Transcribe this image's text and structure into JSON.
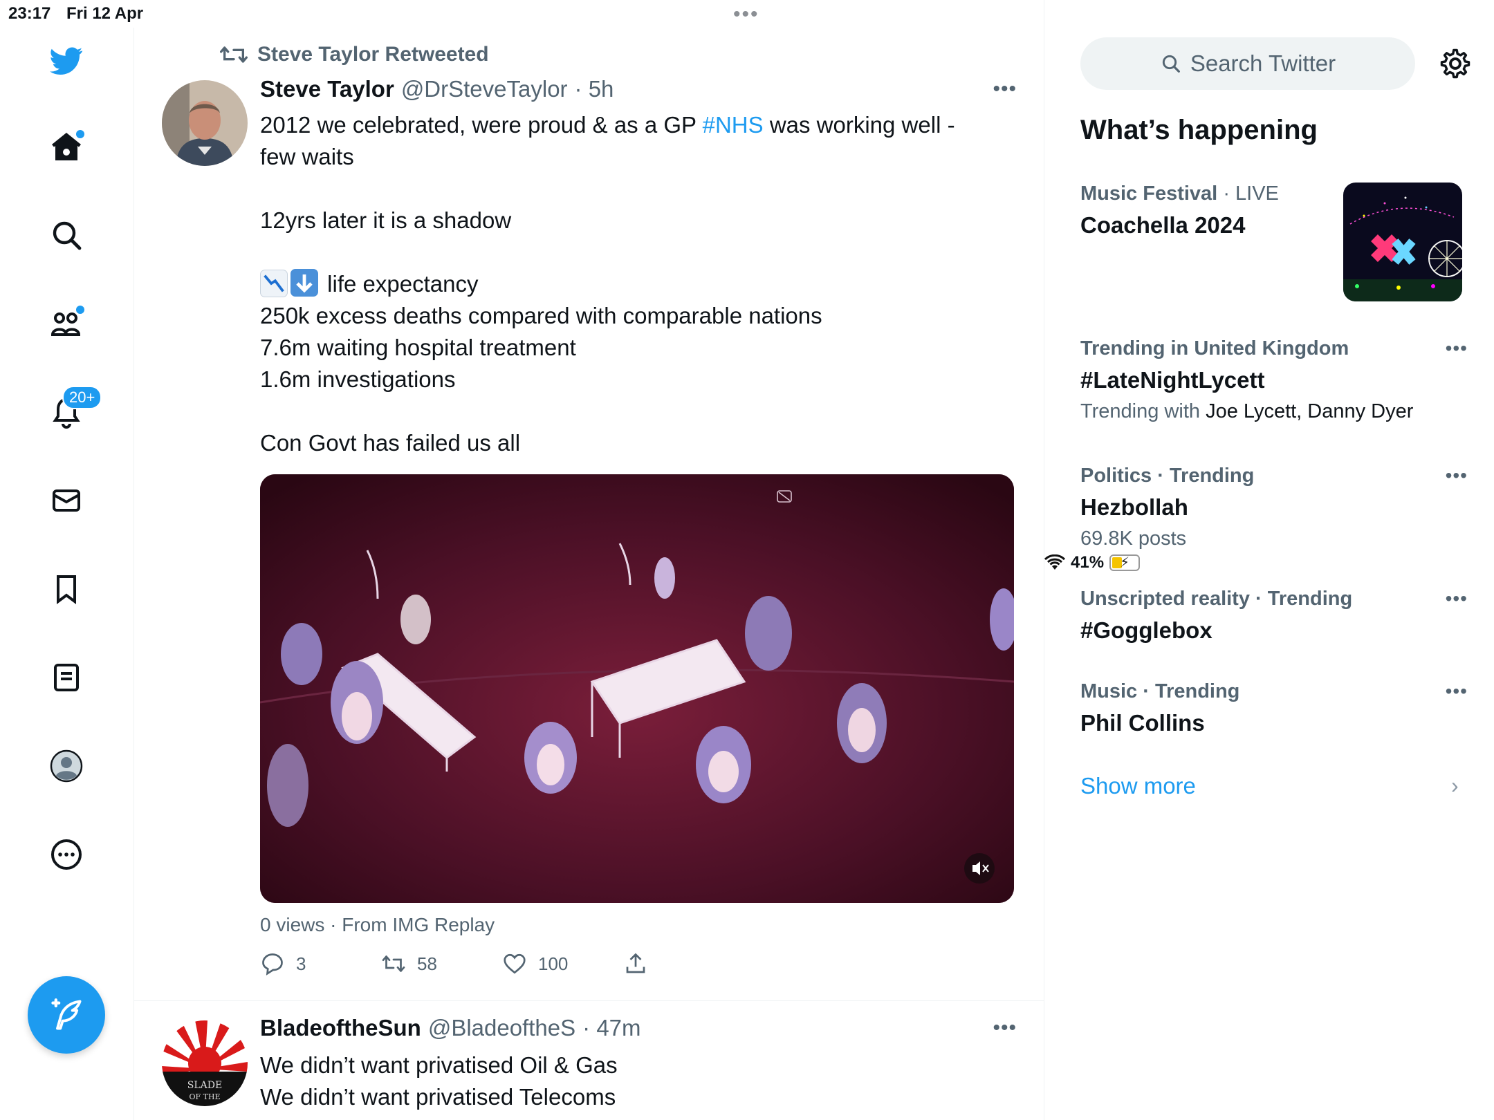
{
  "status_bar": {
    "time": "23:17",
    "date": "Fri 12 Apr",
    "battery": "41%"
  },
  "nav": {
    "notification_badge": "20+"
  },
  "tweet1": {
    "retweeted_by": "Steve Taylor Retweeted",
    "name": "Steve Taylor",
    "handle": "@DrSteveTaylor",
    "time": "· 5h",
    "line1_a": "2012 we celebrated, were proud & as a GP ",
    "line1_tag": "#NHS",
    "line1_b": " was working well -",
    "line2": "few waits",
    "line3": "12yrs later it is a shadow",
    "line4": "life expectancy",
    "line5": "250k excess deaths compared with comparable nations",
    "line6": "7.6m waiting hospital treatment",
    "line7": "1.6m investigations",
    "line8": "Con Govt has failed us all",
    "views": "0 views · From IMG Replay",
    "replies": "3",
    "retweets": "58",
    "likes": "100"
  },
  "tweet2": {
    "name": "BladeoftheSun",
    "handle": "@BladeoftheS",
    "time": "· 47m",
    "line1": "We didn’t want privatised Oil & Gas",
    "line2": "We didn’t want privatised Telecoms"
  },
  "sidebar": {
    "search_placeholder": "Search Twitter",
    "title": "What’s happening",
    "trends": [
      {
        "category": "Music Festival",
        "context": "· LIVE",
        "topic": "Coachella 2024"
      },
      {
        "category": "Trending in United Kingdom",
        "context": "",
        "topic": "#LateNightLycett",
        "sub_prefix": "Trending with ",
        "sub": "Joe Lycett, Danny Dyer"
      },
      {
        "category": "Politics · Trending",
        "context": "",
        "topic": "Hezbollah",
        "sub": "69.8K posts"
      },
      {
        "category": "Unscripted reality · Trending",
        "context": "",
        "topic": "#Gogglebox"
      },
      {
        "category": "Music · Trending",
        "context": "",
        "topic": "Phil Collins"
      }
    ],
    "show_more": "Show more"
  },
  "colors": {
    "accent": "#1d9bf0",
    "secondary_text": "#536471",
    "primary_text": "#0f1419"
  }
}
